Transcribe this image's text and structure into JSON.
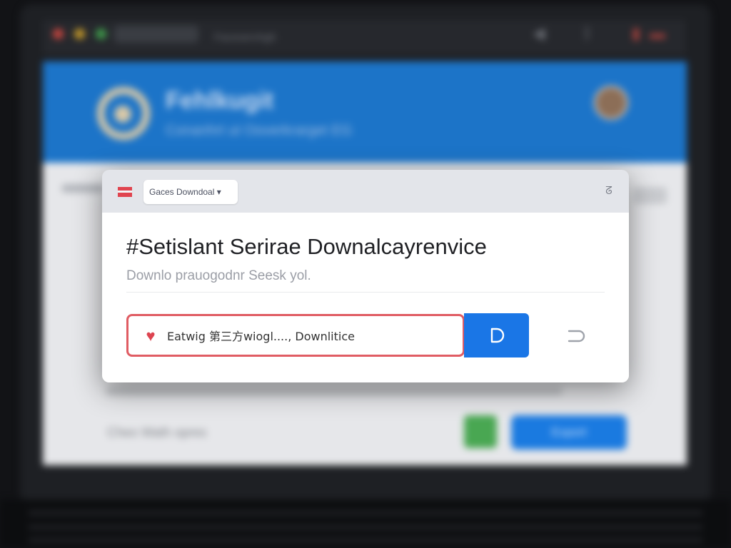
{
  "background": {
    "titlebar_text": "Faceservhgh",
    "app_title": "Fehlkugit",
    "app_subtitle": "Conanhrt ut Ooverkrarget EG",
    "footer_text": "Cheo Wath opres",
    "primary_button_label": "Export"
  },
  "dialog": {
    "tab_label": "Gaces Downdoal ▾",
    "title": "#Setislant Serirae Downalcayrenvice",
    "subtitle": "Downlo prauogodnr Seesk yol.",
    "search": {
      "value": "Eatwig 第三方wiogl...., Downlitice",
      "placeholder": "Eatwig 第三方wiogl...., Downlitice"
    }
  },
  "colors": {
    "accent_blue": "#1a76e6",
    "input_border_red": "#e05c63",
    "heart_red": "#dd4450",
    "header_blue": "#1c74c8"
  },
  "icons": {
    "dialog_flag": "flag-icon",
    "close": "close-icon",
    "search_prefix": "heart-icon",
    "go": "play-icon",
    "refresh": "refresh-icon"
  }
}
